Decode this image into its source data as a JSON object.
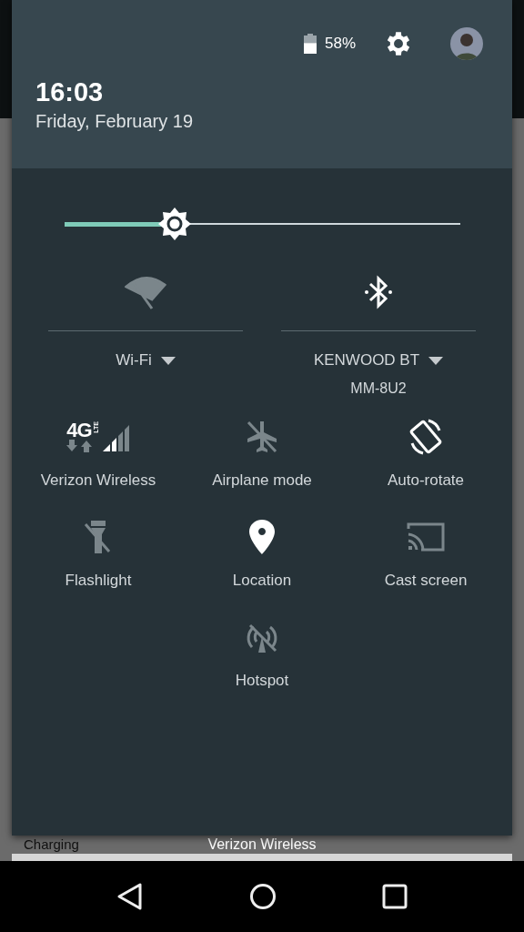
{
  "header": {
    "battery": {
      "reading": "58%"
    },
    "time": "16:03",
    "date": "Friday, February 19"
  },
  "brightness": {
    "level": 0.28
  },
  "big_tiles": [
    {
      "kind": "wifi",
      "on": false,
      "label": "Wi-Fi"
    },
    {
      "kind": "bluetooth",
      "on": true,
      "label": "KENWOOD BT",
      "subtitle": "MM-8U2"
    }
  ],
  "tiles": [
    {
      "kind": "cellular",
      "on": true,
      "label": "Verizon Wireless",
      "badge": "4G",
      "badge_small": "LTE"
    },
    {
      "kind": "airplane",
      "on": false,
      "label": "Airplane mode"
    },
    {
      "kind": "rotate",
      "on": true,
      "label": "Auto-rotate"
    },
    {
      "kind": "flashlight",
      "on": false,
      "label": "Flashlight"
    },
    {
      "kind": "location",
      "on": true,
      "label": "Location"
    },
    {
      "kind": "cast",
      "on": false,
      "label": "Cast screen"
    },
    {
      "kind": "hotspot",
      "on": false,
      "label": "Hotspot"
    }
  ],
  "background": {
    "status": "Charging",
    "carrier": "Verizon Wireless"
  }
}
